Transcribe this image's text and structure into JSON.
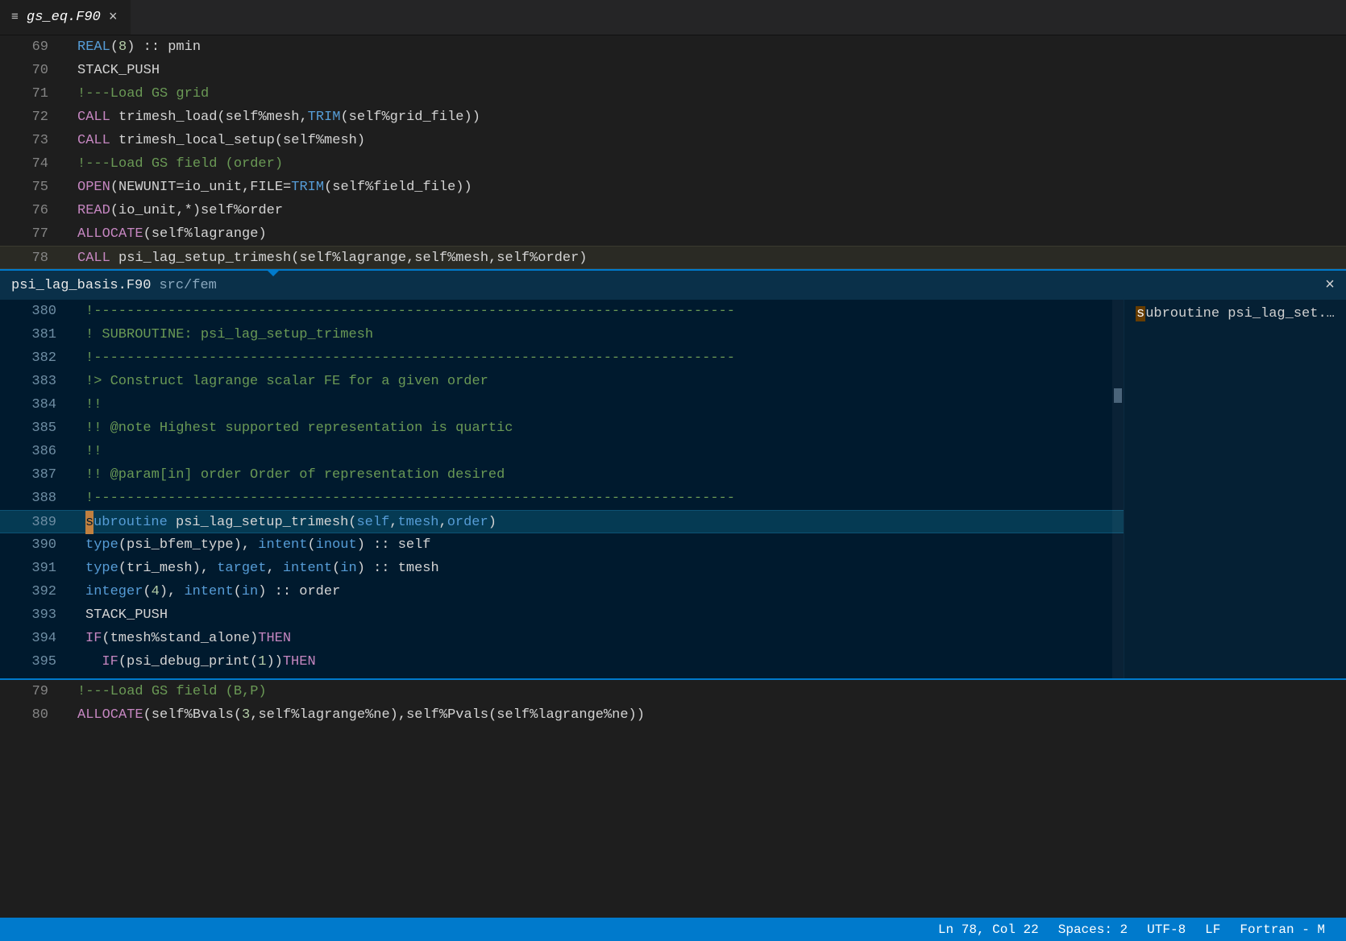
{
  "tab": {
    "filename": "gs_eq.F90"
  },
  "editor": {
    "highlight_line": 78,
    "lines": [
      {
        "n": 69,
        "tokens": [
          [
            "type",
            "REAL"
          ],
          [
            "op",
            "("
          ],
          [
            "num",
            "8"
          ],
          [
            "op",
            ") :: "
          ],
          [
            "id",
            "pmin"
          ]
        ]
      },
      {
        "n": 70,
        "tokens": [
          [
            "id",
            "STACK_PUSH"
          ]
        ]
      },
      {
        "n": 71,
        "tokens": [
          [
            "cm",
            "!---Load GS grid"
          ]
        ]
      },
      {
        "n": 72,
        "tokens": [
          [
            "kw",
            "CALL"
          ],
          [
            "op",
            " "
          ],
          [
            "id",
            "trimesh_load(self%mesh,"
          ],
          [
            "type",
            "TRIM"
          ],
          [
            "id",
            "(self%grid_file))"
          ]
        ]
      },
      {
        "n": 73,
        "tokens": [
          [
            "kw",
            "CALL"
          ],
          [
            "op",
            " "
          ],
          [
            "id",
            "trimesh_local_setup(self%mesh)"
          ]
        ]
      },
      {
        "n": 74,
        "tokens": [
          [
            "cm",
            "!---Load GS field (order)"
          ]
        ]
      },
      {
        "n": 75,
        "tokens": [
          [
            "kw",
            "OPEN"
          ],
          [
            "id",
            "(NEWUNIT=io_unit,FILE="
          ],
          [
            "type",
            "TRIM"
          ],
          [
            "id",
            "(self%field_file))"
          ]
        ]
      },
      {
        "n": 76,
        "tokens": [
          [
            "kw",
            "READ"
          ],
          [
            "id",
            "(io_unit,*)self%order"
          ]
        ]
      },
      {
        "n": 77,
        "tokens": [
          [
            "kw",
            "ALLOCATE"
          ],
          [
            "id",
            "(self%lagrange)"
          ]
        ]
      },
      {
        "n": 78,
        "tokens": [
          [
            "kw",
            "CALL"
          ],
          [
            "op",
            " "
          ],
          [
            "id",
            "psi_lag_setup_trimesh(self%lagrange,self%mesh,self%order)"
          ]
        ]
      }
    ],
    "lines_after": [
      {
        "n": 79,
        "tokens": [
          [
            "cm",
            "!---Load GS field (B,P)"
          ]
        ]
      },
      {
        "n": 80,
        "tokens": [
          [
            "kw",
            "ALLOCATE"
          ],
          [
            "id",
            "(self%Bvals("
          ],
          [
            "num",
            "3"
          ],
          [
            "id",
            ",self%lagrange%ne),self%Pvals(self%lagrange%ne))"
          ]
        ]
      }
    ]
  },
  "peek": {
    "title_file": "psi_lag_basis.F90",
    "title_path": "src/fem",
    "side_item_prefix": "s",
    "side_item_rest": "ubroutine psi_lag_set...",
    "highlight_line": 389,
    "lines": [
      {
        "n": 380,
        "tokens": [
          [
            "cm",
            "!------------------------------------------------------------------------------"
          ]
        ]
      },
      {
        "n": 381,
        "tokens": [
          [
            "cm",
            "! SUBROUTINE: psi_lag_setup_trimesh"
          ]
        ]
      },
      {
        "n": 382,
        "tokens": [
          [
            "cm",
            "!------------------------------------------------------------------------------"
          ]
        ]
      },
      {
        "n": 383,
        "tokens": [
          [
            "cm",
            "!> Construct lagrange scalar FE for a given order"
          ]
        ]
      },
      {
        "n": 384,
        "tokens": [
          [
            "cm",
            "!!"
          ]
        ]
      },
      {
        "n": 385,
        "tokens": [
          [
            "cm",
            "!! @note Highest supported representation is quartic"
          ]
        ]
      },
      {
        "n": 386,
        "tokens": [
          [
            "cm",
            "!!"
          ]
        ]
      },
      {
        "n": 387,
        "tokens": [
          [
            "cm",
            "!! @param[in] order Order of representation desired"
          ]
        ]
      },
      {
        "n": 388,
        "tokens": [
          [
            "cm",
            "!------------------------------------------------------------------------------"
          ]
        ]
      },
      {
        "n": 389,
        "tokens": [
          [
            "mark",
            "s"
          ],
          [
            "type",
            "ubroutine"
          ],
          [
            "op",
            " "
          ],
          [
            "id",
            "psi_lag_setup_trimesh("
          ],
          [
            "type",
            "self"
          ],
          [
            "id",
            ","
          ],
          [
            "type",
            "tmesh"
          ],
          [
            "id",
            ","
          ],
          [
            "type",
            "order"
          ],
          [
            "id",
            ")"
          ]
        ]
      },
      {
        "n": 390,
        "tokens": [
          [
            "type",
            "type"
          ],
          [
            "id",
            "(psi_bfem_type), "
          ],
          [
            "type",
            "intent"
          ],
          [
            "id",
            "("
          ],
          [
            "type",
            "inout"
          ],
          [
            "id",
            ") :: self"
          ]
        ]
      },
      {
        "n": 391,
        "tokens": [
          [
            "type",
            "type"
          ],
          [
            "id",
            "(tri_mesh), "
          ],
          [
            "type",
            "target"
          ],
          [
            "id",
            ", "
          ],
          [
            "type",
            "intent"
          ],
          [
            "id",
            "("
          ],
          [
            "type",
            "in"
          ],
          [
            "id",
            ") :: tmesh"
          ]
        ]
      },
      {
        "n": 392,
        "tokens": [
          [
            "type",
            "integer"
          ],
          [
            "id",
            "("
          ],
          [
            "num",
            "4"
          ],
          [
            "id",
            "), "
          ],
          [
            "type",
            "intent"
          ],
          [
            "id",
            "("
          ],
          [
            "type",
            "in"
          ],
          [
            "id",
            ") :: order"
          ]
        ]
      },
      {
        "n": 393,
        "tokens": [
          [
            "id",
            "STACK_PUSH"
          ]
        ]
      },
      {
        "n": 394,
        "tokens": [
          [
            "kw",
            "IF"
          ],
          [
            "id",
            "(tmesh%stand_alone)"
          ],
          [
            "kw",
            "THEN"
          ]
        ]
      },
      {
        "n": 395,
        "tokens": [
          [
            "op",
            "  "
          ],
          [
            "kw",
            "IF"
          ],
          [
            "id",
            "(psi_debug_print("
          ],
          [
            "num",
            "1"
          ],
          [
            "id",
            "))"
          ],
          [
            "kw",
            "THEN"
          ]
        ]
      }
    ]
  },
  "status": {
    "lncol": "Ln 78, Col 22",
    "spaces": "Spaces: 2",
    "encoding": "UTF-8",
    "eol": "LF",
    "lang": "Fortran - M"
  }
}
